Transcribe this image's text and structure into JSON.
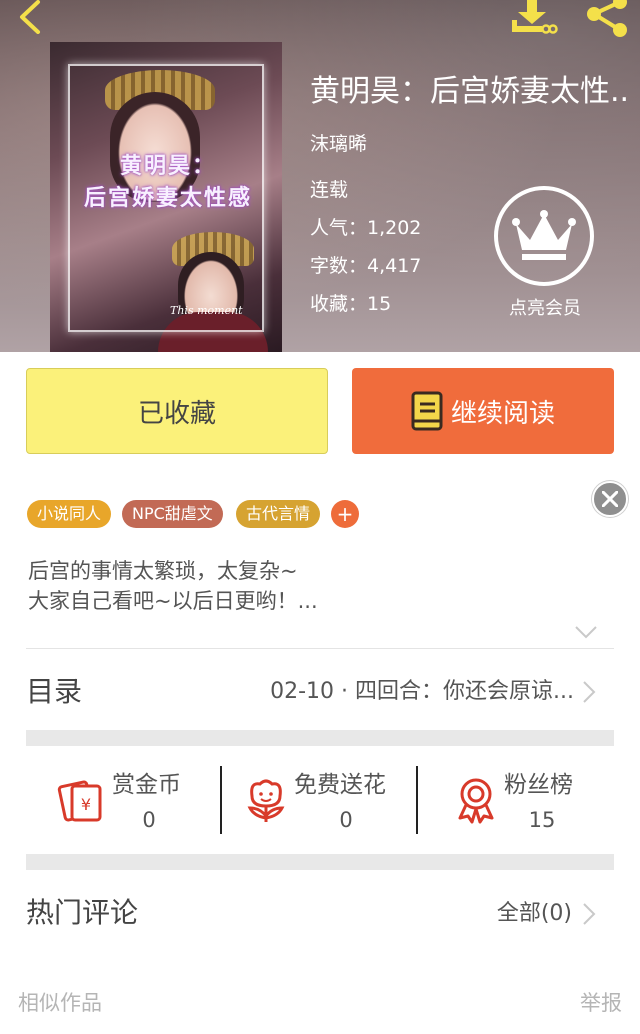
{
  "book": {
    "title": "黄明昊：后宫娇妻太性..",
    "author": "沫璃晞",
    "status": "连载",
    "popularity": "人气：1,202",
    "word_count": "字数：4,417",
    "favorites": "收藏：15",
    "cover_title_line1": "黄明昊：",
    "cover_title_line2": "后宫娇妻太性感",
    "cover_sub": "This moment"
  },
  "vip": {
    "label": "点亮会员"
  },
  "actions": {
    "collected_label": "已收藏",
    "read_label": "继续阅读"
  },
  "tags": [
    {
      "label": "小说同人",
      "color": "#e8a62a"
    },
    {
      "label": "NPC甜虐文",
      "color": "#c26a55"
    },
    {
      "label": "古代言情",
      "color": "#d6a331"
    }
  ],
  "tag_add": "+",
  "synopsis": {
    "line1": "后宫的事情太繁琐，太复杂~",
    "line2": "大家自己看吧~以后日更哟！..."
  },
  "catalog": {
    "label": "目录",
    "latest": "02-10 · 四回合：你还会原谅..."
  },
  "support": [
    {
      "label": "赏金币",
      "count": "0",
      "icon": "red-envelope-coin-icon"
    },
    {
      "label": "免费送花",
      "count": "0",
      "icon": "flower-icon"
    },
    {
      "label": "粉丝榜",
      "count": "15",
      "icon": "medal-icon"
    }
  ],
  "comments": {
    "label": "热门评论",
    "all_label": "全部(0)"
  },
  "footer": {
    "similar": "相似作品",
    "report": "举报"
  },
  "colors": {
    "accent_orange": "#f06c3c",
    "collected_yellow": "#fbf17a",
    "icon_yellow": "#f4e04a",
    "icon_red": "#d83a2a"
  }
}
